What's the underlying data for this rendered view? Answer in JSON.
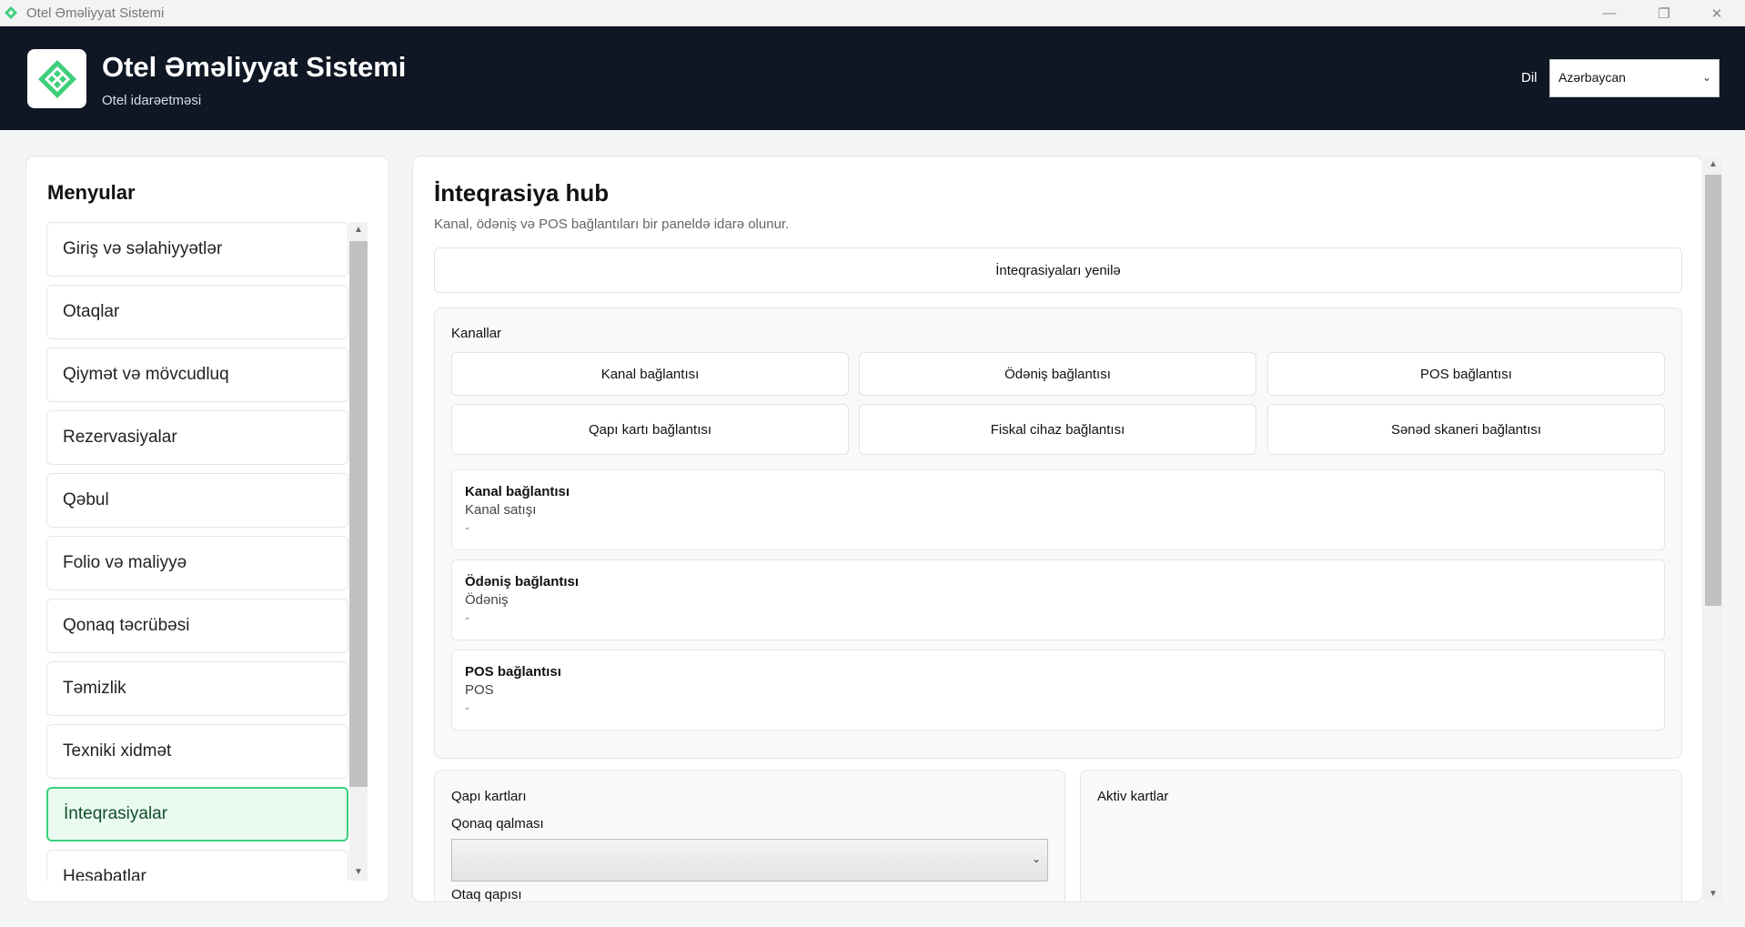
{
  "window": {
    "title": "Otel Əməliyyat Sistemi",
    "minimize": "—",
    "restore": "❐",
    "close": "✕"
  },
  "header": {
    "title": "Otel Əməliyyat Sistemi",
    "subtitle": "Otel idarəetməsi",
    "language_label": "Dil",
    "language_value": "Azərbaycan",
    "logo_color": "#3ecf7a"
  },
  "sidebar": {
    "title": "Menyular",
    "items": [
      {
        "label": "Giriş və səlahiyyətlər"
      },
      {
        "label": "Otaqlar"
      },
      {
        "label": "Qiymət və mövcudluq"
      },
      {
        "label": "Rezervasiyalar"
      },
      {
        "label": "Qəbul"
      },
      {
        "label": "Folio və maliyyə"
      },
      {
        "label": "Qonaq təcrübəsi"
      },
      {
        "label": "Təmizlik"
      },
      {
        "label": "Texniki xidmət"
      },
      {
        "label": "İnteqrasiyalar"
      },
      {
        "label": "Hesabatlar"
      }
    ],
    "active_index": 9
  },
  "main": {
    "title": "İnteqrasiya hub",
    "description": "Kanal, ödəniş və POS bağlantıları bir paneldə idarə olunur.",
    "refresh_label": "İnteqrasiyaları yenilə",
    "channels": {
      "title": "Kanallar",
      "buttons": [
        {
          "label": "Kanal bağlantısı"
        },
        {
          "label": "Ödəniş bağlantısı"
        },
        {
          "label": "POS bağlantısı"
        },
        {
          "label": "Qapı kartı bağlantısı"
        },
        {
          "label": "Fiskal cihaz bağlantısı"
        },
        {
          "label": "Sənəd skaneri bağlantısı"
        }
      ],
      "connections": [
        {
          "name": "Kanal bağlantısı",
          "type": "Kanal satışı",
          "status": "-"
        },
        {
          "name": "Ödəniş bağlantısı",
          "type": "Ödəniş",
          "status": "-"
        },
        {
          "name": "POS bağlantısı",
          "type": "POS",
          "status": "-"
        }
      ]
    },
    "door_cards": {
      "title": "Qapı kartları",
      "stay_label": "Qonaq qalması",
      "stay_value": "",
      "room_door_label": "Otaq qapısı"
    },
    "active_cards": {
      "title": "Aktiv kartlar"
    }
  }
}
